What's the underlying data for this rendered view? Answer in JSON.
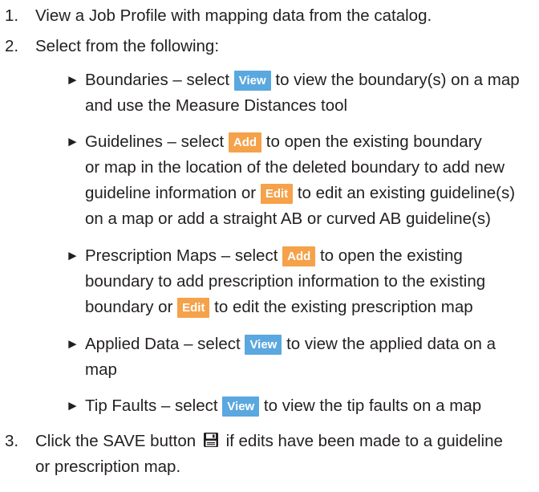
{
  "steps": [
    {
      "num": "1.",
      "text": "View a Job Profile with mapping data from the catalog."
    },
    {
      "num": "2.",
      "text": "Select from the following:"
    },
    {
      "num": "3.",
      "text_before": "Click the SAVE button",
      "text_after": "if edits have been made to a guideline",
      "text_line2": "or prescription map."
    }
  ],
  "items": [
    {
      "bullet": "►",
      "lines": [
        {
          "pre": "Boundaries – select",
          "btn": "View",
          "post": "to view the boundary(s) on a map"
        },
        {
          "pre": "and use the Measure Distances tool"
        }
      ]
    },
    {
      "bullet": "►",
      "lines": [
        {
          "pre": "Guidelines – select",
          "btn": "Add",
          "post": "to open the existing boundary"
        },
        {
          "pre": "or map in the location of the deleted boundary to add new"
        },
        {
          "pre": "guideline information or",
          "btn": "Edit",
          "post": "to edit an existing guideline(s)"
        },
        {
          "pre": "on a map or add a straight AB or curved AB guideline(s)"
        }
      ]
    },
    {
      "bullet": "►",
      "lines": [
        {
          "pre": "Prescription Maps – select",
          "btn": "Add",
          "post": "to open the existing"
        },
        {
          "pre": "boundary to add prescription information to the existing"
        },
        {
          "pre": "boundary or",
          "btn": "Edit",
          "post": "to edit the existing prescription map"
        }
      ]
    },
    {
      "bullet": "►",
      "lines": [
        {
          "pre": "Applied Data – select",
          "btn": "View",
          "post": "to view the applied data on a"
        },
        {
          "pre": "map"
        }
      ]
    },
    {
      "bullet": "►",
      "lines": [
        {
          "pre": "Tip Faults – select",
          "btn": "View",
          "post": "to view the tip faults on a map"
        }
      ]
    }
  ],
  "colors": {
    "view_button": "#5aa8df",
    "add_edit_button": "#f5a24a",
    "text": "#231f20"
  },
  "icons": {
    "save": "save-icon"
  }
}
